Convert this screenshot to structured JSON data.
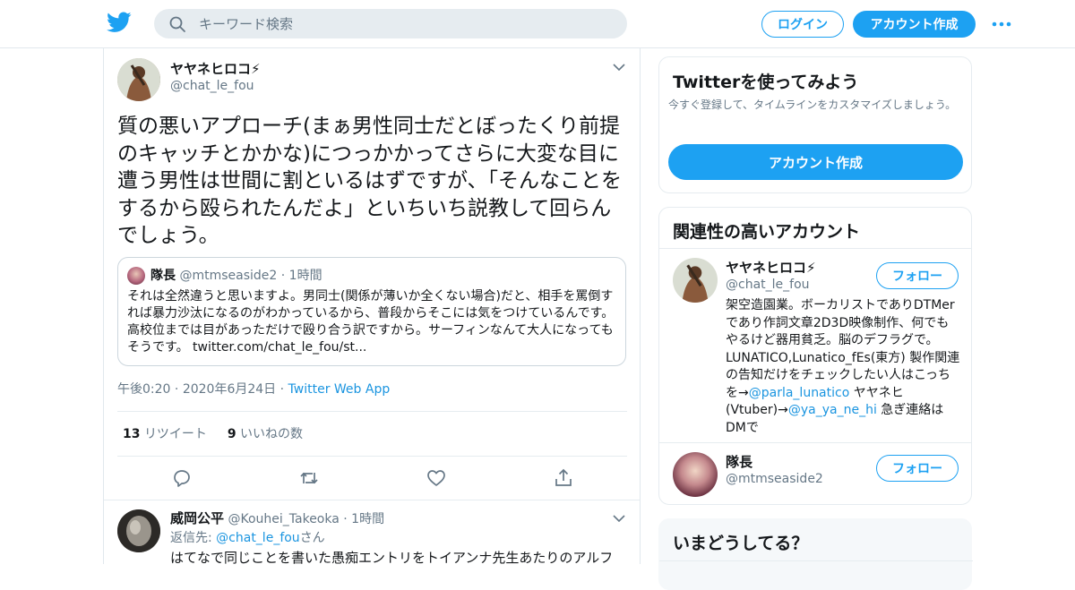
{
  "header": {
    "search_placeholder": "キーワード検索",
    "login_label": "ログイン",
    "signup_label": "アカウント作成"
  },
  "tweet": {
    "author_name": "ヤヤネヒロコ⚡",
    "author_handle": "@chat_le_fou",
    "text": "質の悪いアプローチ(まぁ男性同士だとぼったくり前提のキャッチとかかな)につっかかってさらに大変な目に遭う男性は世間に割といるはずですが、「そんなことをするから殴られたんだよ」といちいち説教して回らんでしょう。",
    "quote": {
      "author_name": "隊長",
      "author_handle": "@mtmseaside2",
      "time": "1時間",
      "text": "それは全然違うと思いますよ。男同士(関係が薄いか全くない場合)だと、相手を罵倒すれば暴力沙汰になるのがわかっているから、普段からそこには気をつけているんです。高校位までは目があっただけで殴り合う訳ですから。サーフィンなんて大人になってもそうです。 twitter.com/chat_le_fou/st..."
    },
    "time": "午後0:20",
    "date": "2020年6月24日",
    "source": "Twitter Web App",
    "retweet_count": "13",
    "retweet_label": "リツイート",
    "like_count": "9",
    "like_label": "いいねの数"
  },
  "reply": {
    "author_name": "威岡公平",
    "author_handle": "@Kouhei_Takeoka",
    "time": "1時間",
    "reply_to_label": "返信先:",
    "reply_to_handle": "@chat_le_fou",
    "reply_to_suffix": "さん",
    "text": "はてなで同じことを書いた愚痴エントリをトイアンナ先生あたりのアルフ"
  },
  "sidebar": {
    "signup_card": {
      "title": "Twitterを使ってみよう",
      "description": "今すぐ登録して、タイムラインをカスタマイズしましょう。",
      "button": "アカウント作成"
    },
    "related": {
      "title": "関連性の高いアカウント",
      "follow_label": "フォロー",
      "accounts": [
        {
          "name": "ヤヤネヒロコ⚡",
          "handle": "@chat_le_fou",
          "bio_1": "架空造園業。ボーカリストでありDTMerであり作詞文章2D3D映像制作、何でもやるけど器用貧乏。脳のデフラグで。LUNATICO,Lunatico_fEs(東方) 製作関連の告知だけをチェックしたい人はこっちを→",
          "bio_link_1": "@parla_lunatico",
          "bio_2": " ヤヤネヒ(Vtuber)→",
          "bio_link_2": "@ya_ya_ne_hi",
          "bio_3": " 急ぎ連絡はDMで"
        },
        {
          "name": "隊長",
          "handle": "@mtmseaside2"
        }
      ]
    },
    "trends": {
      "title": "いまどうしてる？"
    }
  },
  "colors": {
    "accent": "#1da1f2",
    "link": "#1b95e0",
    "muted": "#657786",
    "border": "#e6ecf0"
  }
}
